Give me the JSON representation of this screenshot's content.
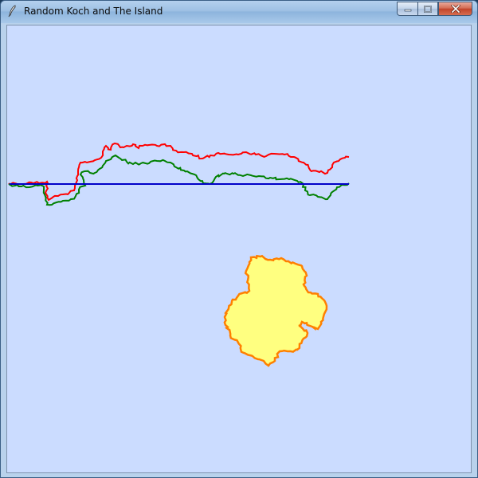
{
  "window": {
    "title": "Random Koch and The Island",
    "controls": {
      "minimize": "minimize",
      "maximize": "maximize",
      "close": "close"
    }
  },
  "icons": {
    "app": "feather-icon",
    "minimize": "minimize-icon",
    "maximize": "maximize-icon",
    "close": "close-icon"
  },
  "canvas": {
    "background": "#cbdcff",
    "colors": {
      "red_curve": "#ff0000",
      "green_curve": "#008000",
      "blue_line": "#0000c8",
      "island_fill": "#ffff80",
      "island_stroke": "#ff8000"
    }
  }
}
